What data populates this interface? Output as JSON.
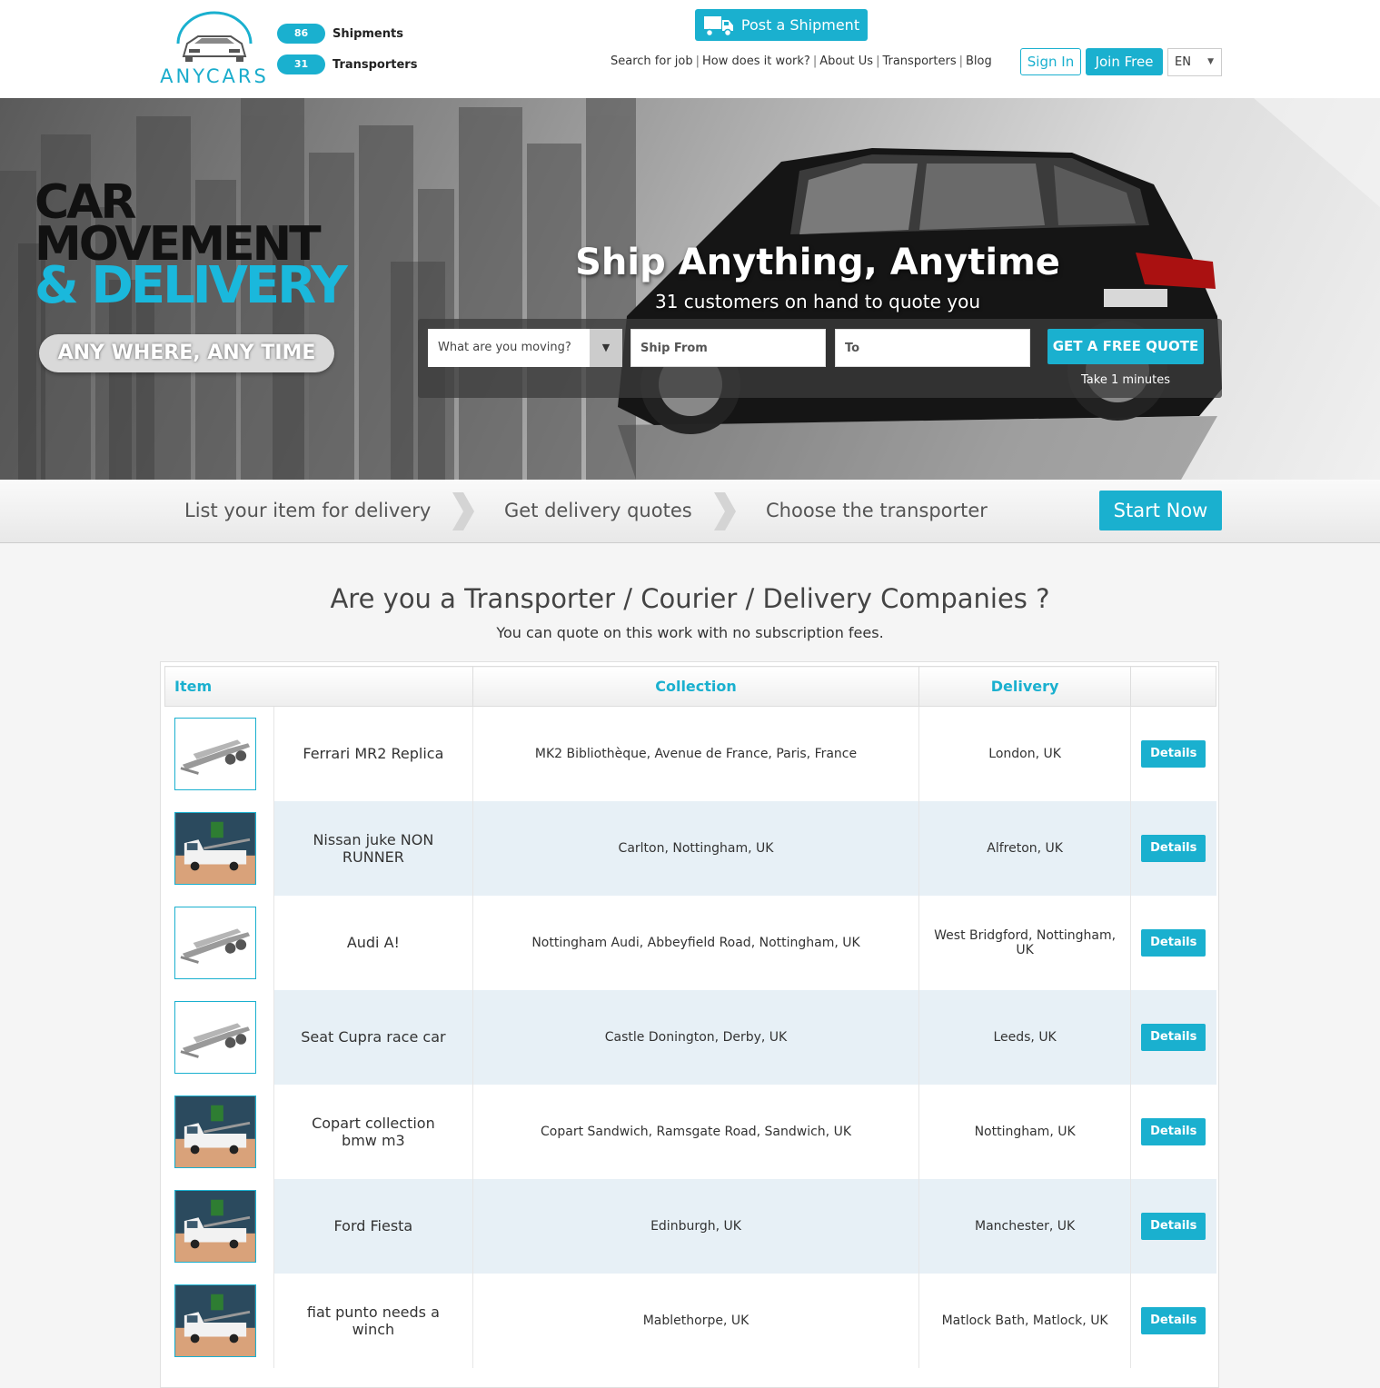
{
  "brand": {
    "name": "ANYCARS"
  },
  "stats": [
    {
      "count": "86",
      "label": "Shipments"
    },
    {
      "count": "31",
      "label": "Transporters"
    }
  ],
  "header": {
    "post_label": "Post a Shipment",
    "nav": [
      "Search for job",
      "How does it work?",
      "About Us",
      "Transporters",
      "Blog"
    ],
    "signin": "Sign In",
    "join": "Join Free",
    "lang": "EN"
  },
  "hero": {
    "line1": "CAR",
    "line2": "MOVEMENT",
    "line3": "& DELIVERY",
    "tagline": "ANY WHERE, ANY TIME",
    "title": "Ship Anything, Anytime",
    "subtitle": "31 customers on hand to quote you",
    "select_placeholder": "What are you moving?",
    "from_placeholder": "Ship From",
    "to_placeholder": "To",
    "quote_button": "GET A FREE QUOTE",
    "quote_note": "Take 1 minutes"
  },
  "steps": {
    "s1": "List your item for delivery",
    "s2": "Get delivery quotes",
    "s3": "Choose the transporter",
    "start": "Start Now"
  },
  "section": {
    "title": "Are you a Transporter / Courier / Delivery Companies ?",
    "subtitle": "You can quote on this work with no subscription fees."
  },
  "table": {
    "headers": {
      "item": "Item",
      "collection": "Collection",
      "delivery": "Delivery"
    },
    "details_label": "Details",
    "rows": [
      {
        "item": "Ferrari MR2 Replica",
        "collection": "MK2 Bibliothèque, Avenue de France, Paris, France",
        "delivery": "London, UK",
        "thumb": "trailer-icon"
      },
      {
        "item": "Nissan juke NON RUNNER",
        "collection": "Carlton, Nottingham, UK",
        "delivery": "Alfreton, UK",
        "thumb": "recovery-truck-icon"
      },
      {
        "item": "Audi A!",
        "collection": "Nottingham Audi, Abbeyfield Road, Nottingham, UK",
        "delivery": "West Bridgford, Nottingham, UK",
        "thumb": "trailer-icon"
      },
      {
        "item": "Seat Cupra race car",
        "collection": "Castle Donington, Derby, UK",
        "delivery": "Leeds, UK",
        "thumb": "trailer-icon"
      },
      {
        "item": "Copart collection bmw m3",
        "collection": "Copart Sandwich, Ramsgate Road, Sandwich, UK",
        "delivery": "Nottingham, UK",
        "thumb": "recovery-truck-icon"
      },
      {
        "item": "Ford Fiesta",
        "collection": "Edinburgh, UK",
        "delivery": "Manchester, UK",
        "thumb": "recovery-truck-icon"
      },
      {
        "item": "fiat punto needs a winch",
        "collection": "Mablethorpe, UK",
        "delivery": "Matlock Bath, Matlock, UK",
        "thumb": "recovery-truck-icon"
      }
    ]
  },
  "colors": {
    "accent": "#1ab0cf",
    "row_alt": "#e7f0f6",
    "headline_blue": "#1ab8dc"
  }
}
